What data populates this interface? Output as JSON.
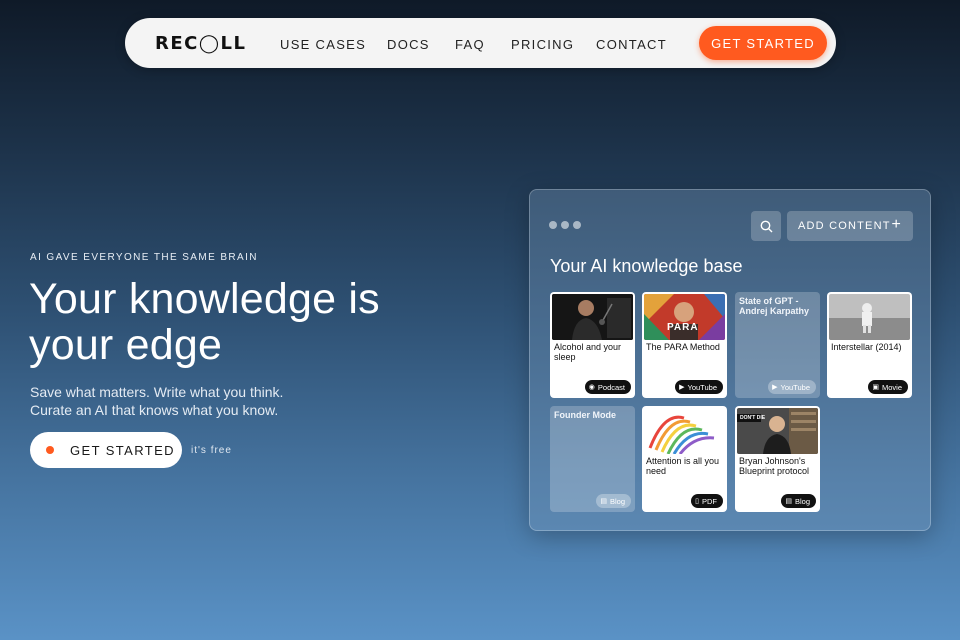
{
  "nav": {
    "logo": "REC◯LL",
    "links": [
      "USE CASES",
      "DOCS",
      "FAQ",
      "PRICING",
      "CONTACT"
    ],
    "cta": "GET STARTED"
  },
  "hero": {
    "eyebrow": "AI GAVE EVERYONE THE SAME BRAIN",
    "headline_line1": "Your knowledge is",
    "headline_line2": "your edge",
    "sub_line1": "Save what matters. Write what you think.",
    "sub_line2": "Curate an AI that knows what you know.",
    "cta": "GET STARTED",
    "cta_note": "it's free"
  },
  "panel": {
    "add_content": "ADD CONTENT",
    "title": "Your AI knowledge base",
    "cards": [
      {
        "title": "Alcohol and your sleep",
        "type": "Podcast",
        "icon": "podcast-icon"
      },
      {
        "title": "The PARA Method",
        "type": "YouTube",
        "icon": "youtube-icon",
        "thumb_text": "PARA"
      },
      {
        "title": "State of GPT - Andrej Karpathy",
        "type": "YouTube",
        "icon": "youtube-icon"
      },
      {
        "title": "Interstellar (2014)",
        "type": "Movie",
        "icon": "movie-icon"
      },
      {
        "title": "Founder Mode",
        "type": "Blog",
        "icon": "blog-icon"
      },
      {
        "title": "Attention is all you need",
        "type": "PDF",
        "icon": "pdf-icon"
      },
      {
        "title": "Bryan Johnson's Blueprint protocol",
        "type": "Blog",
        "icon": "blog-icon",
        "thumb_text": "DON'T DIE"
      }
    ]
  },
  "colors": {
    "accent": "#ff5a1f",
    "nav_bg": "#f4f4f4",
    "bg_top": "#0f1a28",
    "bg_bottom": "#5a92c6"
  }
}
